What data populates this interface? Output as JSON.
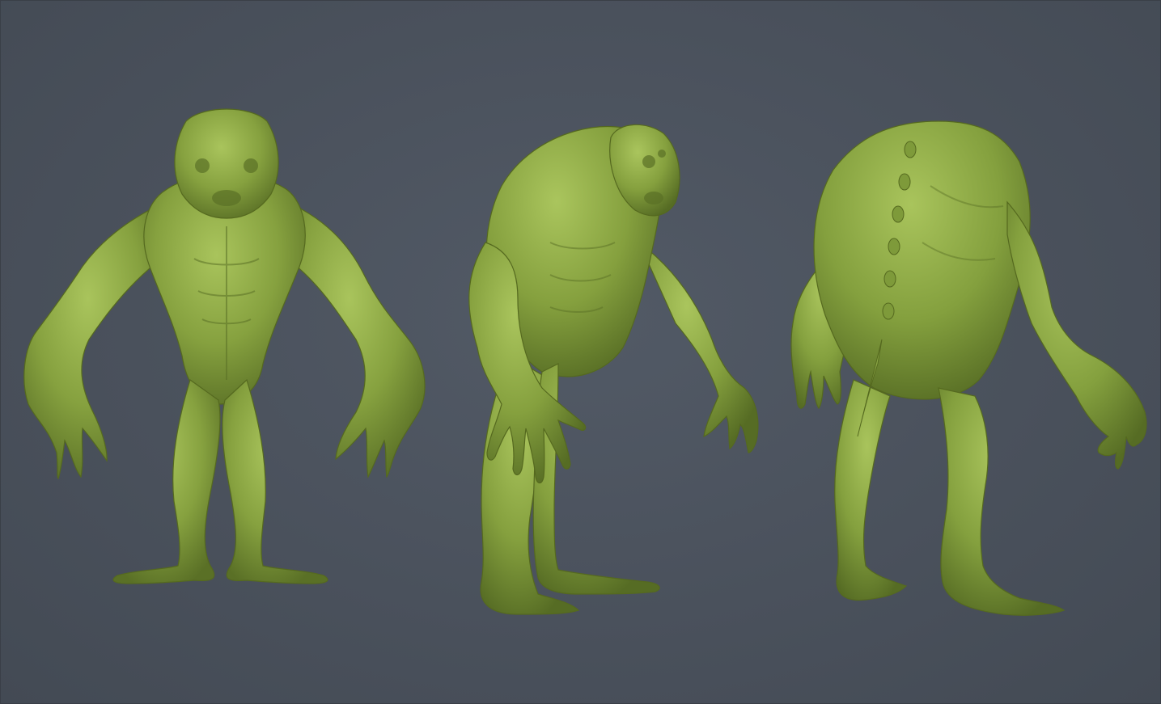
{
  "scene": {
    "background_color": "#4a515c",
    "material_color": "#7f9a3a",
    "material_highlight": "#a7c25a",
    "material_shadow": "#4f6420"
  },
  "views": [
    {
      "name": "front-view",
      "subject": "creature-sculpt"
    },
    {
      "name": "three-quarter-view",
      "subject": "creature-sculpt"
    },
    {
      "name": "back-view",
      "subject": "creature-sculpt"
    }
  ]
}
